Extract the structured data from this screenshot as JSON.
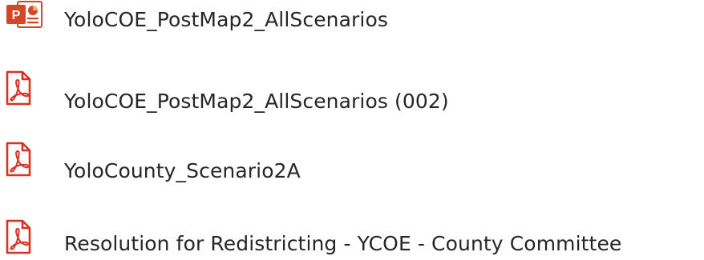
{
  "files": [
    {
      "name": "YoloCOE_PostMap2_AllScenarios",
      "icon": "powerpoint-file-icon",
      "type": "pptx"
    },
    {
      "name": "YoloCOE_PostMap2_AllScenarios (002)",
      "icon": "pdf-file-icon",
      "type": "pdf"
    },
    {
      "name": "YoloCounty_Scenario2A",
      "icon": "pdf-file-icon",
      "type": "pdf"
    },
    {
      "name": "Resolution for Redistricting - YCOE - County Committee",
      "icon": "pdf-file-icon",
      "type": "pdf"
    }
  ],
  "colors": {
    "powerpoint": "#d24726",
    "pdf": "#d93025",
    "text": "#262626",
    "background": "#ffffff"
  }
}
